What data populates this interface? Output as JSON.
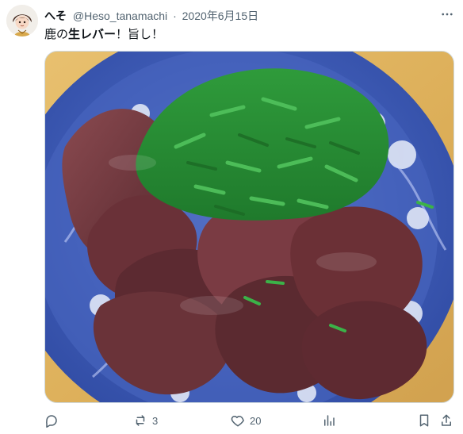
{
  "post": {
    "display_name": "へそ",
    "handle": "@Heso_tanamachi",
    "separator": "·",
    "date": "2020年6月15日",
    "text_prefix": "鹿の",
    "text_bold": "生レバー",
    "text_suffix": "！旨し！"
  },
  "actions": {
    "reply_count": "",
    "repost_count": "3",
    "like_count": "20",
    "views_count": ""
  },
  "colors": {
    "text_primary": "#0f1419",
    "text_secondary": "#536471",
    "border": "#cfd9de"
  },
  "icons": {
    "reply": "reply-icon",
    "repost": "repost-icon",
    "like": "heart-icon",
    "views": "views-icon",
    "bookmark": "bookmark-icon",
    "share": "share-icon",
    "more": "more-icon"
  }
}
